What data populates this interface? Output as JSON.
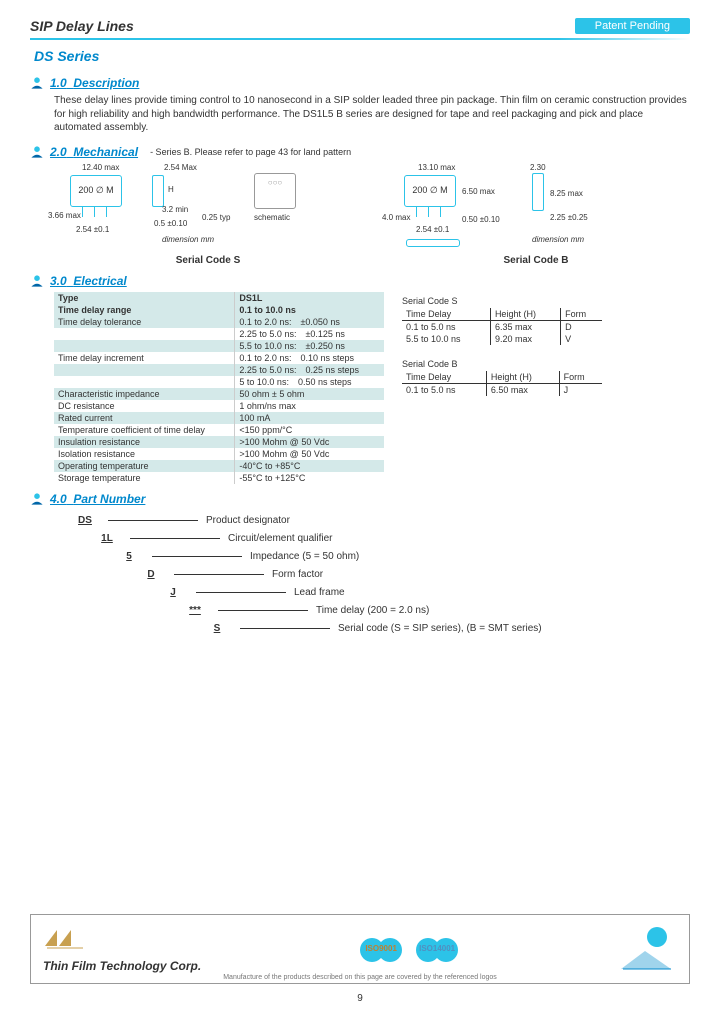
{
  "header": {
    "title": "SIP Delay Lines",
    "patent": "Patent Pending"
  },
  "series": "DS Series",
  "sections": {
    "s1": {
      "num": "1.0",
      "title": "Description"
    },
    "s2": {
      "num": "2.0",
      "title": "Mechanical",
      "sub": "- Series B. Please refer to page 43 for land pattern"
    },
    "s3": {
      "num": "3.0",
      "title": "Electrical"
    },
    "s4": {
      "num": "4.0",
      "title": "Part Number"
    }
  },
  "description": "These delay lines provide timing control to 10 nanosecond in a SIP solder leaded three pin package. Thin film on ceramic construction provides for high reliability and high bandwidth performance. The DS1L5 B series are designed for tape and reel packaging and pick and place automated assembly.",
  "mechanical": {
    "codeS": "Serial Code  S",
    "codeB": "Serial Code  B",
    "chip_label": "200 ∅ M",
    "schematic": "schematic",
    "dim_mm": "dimension mm",
    "s": {
      "w": "12.40 max",
      "t": "2.54 Max",
      "h": "H",
      "pin_h": "3.2 min",
      "pin_sp": "0.5 ±0.10",
      "pin_typ": "0.25 typ",
      "left": "3.66 max",
      "pitch": "2.54 ±0.1"
    },
    "b": {
      "w": "13.10 max",
      "h": "6.50 max",
      "side_w": "2.30",
      "side_h": "8.25 max",
      "lead_l": "2.25 ±0.25",
      "left": "4.0 max",
      "pitch": "2.54 ±0.1",
      "pin_sp": "0.50 ±0.10"
    }
  },
  "electrical": {
    "type_hdr": "Type",
    "type_val": "DS1L",
    "rows": [
      {
        "p": "Time delay range",
        "v": "0.1 to 10.0 ns"
      },
      {
        "p": "Time delay tolerance",
        "v": "0.1 to 2.0 ns: ±0.050 ns\n2.25 to 5.0 ns: ±0.125 ns\n5.5 to 10.0 ns: ±0.250 ns"
      },
      {
        "p": "Time delay increment",
        "v": "0.1 to 2.0 ns: 0.10 ns steps\n2.25 to 5.0 ns: 0.25 ns steps\n5 to 10.0 ns: 0.50 ns steps"
      },
      {
        "p": "Characteristic impedance",
        "v": "50 ohm ± 5 ohm"
      },
      {
        "p": "DC resistance",
        "v": "1 ohm/ns max"
      },
      {
        "p": "Rated current",
        "v": "100 mA"
      },
      {
        "p": "Temperature coefficient of time delay",
        "v": "<150 ppm/°C"
      },
      {
        "p": "Insulation resistance",
        "v": ">100 Mohm @ 50 Vdc"
      },
      {
        "p": "Isolation resistance",
        "v": ">100 Mohm @ 50 Vdc"
      },
      {
        "p": "Operating temperature",
        "v": "-40°C to +85°C"
      },
      {
        "p": "Storage temperature",
        "v": "-55°C to +125°C"
      }
    ],
    "serialS": {
      "title": "Serial Code S",
      "cols": [
        "Time Delay",
        "Height (H)",
        "Form"
      ],
      "rows": [
        [
          "0.1 to 5.0 ns",
          "6.35 max",
          "D"
        ],
        [
          "5.5 to 10.0 ns",
          "9.20 max",
          "V"
        ]
      ]
    },
    "serialB": {
      "title": "Serial Code  B",
      "cols": [
        "Time Delay",
        "Height (H)",
        "Form"
      ],
      "rows": [
        [
          "0.1 to 5.0 ns",
          "6.50 max",
          "J"
        ]
      ]
    }
  },
  "part_number": [
    {
      "code": "DS",
      "label": "Product designator"
    },
    {
      "code": "1L",
      "label": "Circuit/element qualifier"
    },
    {
      "code": "5",
      "label": "Impedance (5 = 50 ohm)"
    },
    {
      "code": "D",
      "label": "Form factor"
    },
    {
      "code": "J",
      "label": "Lead frame"
    },
    {
      "code": "***",
      "label": "Time delay (200 = 2.0 ns)"
    },
    {
      "code": "S",
      "label": "Serial code (S = SIP series), (B = SMT series)"
    }
  ],
  "footer": {
    "company": "Thin Film Technology Corp.",
    "badge1": "ISO9001",
    "badge2": "ISO14001",
    "disclaimer": "Manufacture of the products described on this page are covered by the referenced logos"
  },
  "page_number": "9"
}
